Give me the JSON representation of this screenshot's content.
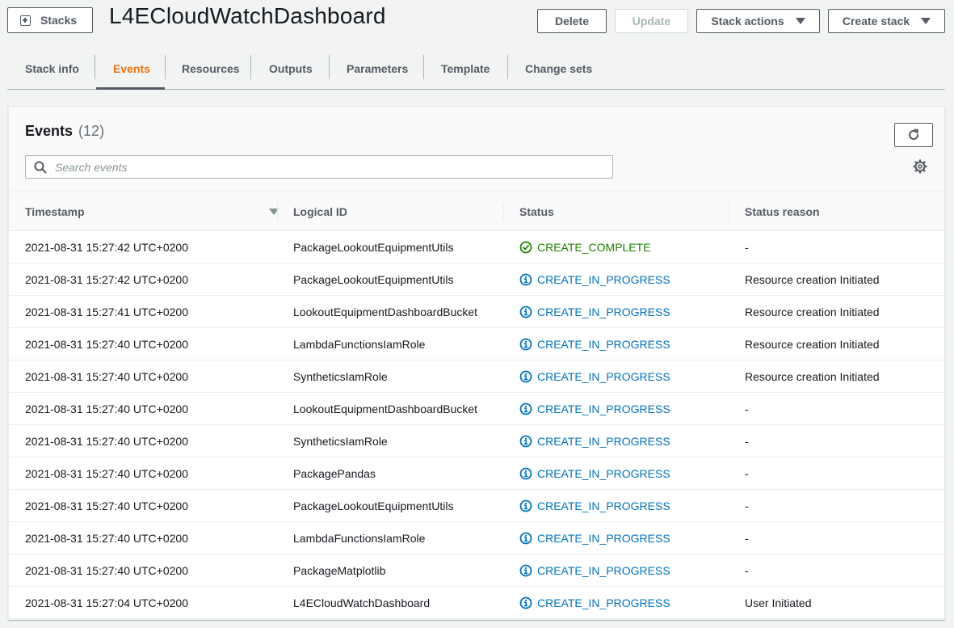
{
  "header": {
    "stacks_label": "Stacks",
    "title": "L4ECloudWatchDashboard",
    "delete_label": "Delete",
    "update_label": "Update",
    "stack_actions_label": "Stack actions",
    "create_stack_label": "Create stack"
  },
  "tabs": [
    {
      "label": "Stack info"
    },
    {
      "label": "Events",
      "active": true
    },
    {
      "label": "Resources"
    },
    {
      "label": "Outputs"
    },
    {
      "label": "Parameters"
    },
    {
      "label": "Template"
    },
    {
      "label": "Change sets"
    }
  ],
  "events": {
    "title": "Events",
    "count": "(12)",
    "search_placeholder": "Search events",
    "columns": {
      "timestamp": "Timestamp",
      "logical_id": "Logical ID",
      "status": "Status",
      "status_reason": "Status reason"
    },
    "rows": [
      {
        "timestamp": "2021-08-31 15:27:42 UTC+0200",
        "logical_id": "PackageLookoutEquipmentUtils",
        "status": "CREATE_COMPLETE",
        "status_type": "complete",
        "reason": "-"
      },
      {
        "timestamp": "2021-08-31 15:27:42 UTC+0200",
        "logical_id": "PackageLookoutEquipmentUtils",
        "status": "CREATE_IN_PROGRESS",
        "status_type": "progress",
        "reason": "Resource creation Initiated"
      },
      {
        "timestamp": "2021-08-31 15:27:41 UTC+0200",
        "logical_id": "LookoutEquipmentDashboardBucket",
        "status": "CREATE_IN_PROGRESS",
        "status_type": "progress",
        "reason": "Resource creation Initiated"
      },
      {
        "timestamp": "2021-08-31 15:27:40 UTC+0200",
        "logical_id": "LambdaFunctionsIamRole",
        "status": "CREATE_IN_PROGRESS",
        "status_type": "progress",
        "reason": "Resource creation Initiated"
      },
      {
        "timestamp": "2021-08-31 15:27:40 UTC+0200",
        "logical_id": "SyntheticsIamRole",
        "status": "CREATE_IN_PROGRESS",
        "status_type": "progress",
        "reason": "Resource creation Initiated"
      },
      {
        "timestamp": "2021-08-31 15:27:40 UTC+0200",
        "logical_id": "LookoutEquipmentDashboardBucket",
        "status": "CREATE_IN_PROGRESS",
        "status_type": "progress",
        "reason": "-"
      },
      {
        "timestamp": "2021-08-31 15:27:40 UTC+0200",
        "logical_id": "SyntheticsIamRole",
        "status": "CREATE_IN_PROGRESS",
        "status_type": "progress",
        "reason": "-"
      },
      {
        "timestamp": "2021-08-31 15:27:40 UTC+0200",
        "logical_id": "PackagePandas",
        "status": "CREATE_IN_PROGRESS",
        "status_type": "progress",
        "reason": "-"
      },
      {
        "timestamp": "2021-08-31 15:27:40 UTC+0200",
        "logical_id": "PackageLookoutEquipmentUtils",
        "status": "CREATE_IN_PROGRESS",
        "status_type": "progress",
        "reason": "-"
      },
      {
        "timestamp": "2021-08-31 15:27:40 UTC+0200",
        "logical_id": "LambdaFunctionsIamRole",
        "status": "CREATE_IN_PROGRESS",
        "status_type": "progress",
        "reason": "-"
      },
      {
        "timestamp": "2021-08-31 15:27:40 UTC+0200",
        "logical_id": "PackageMatplotlib",
        "status": "CREATE_IN_PROGRESS",
        "status_type": "progress",
        "reason": "-"
      },
      {
        "timestamp": "2021-08-31 15:27:04 UTC+0200",
        "logical_id": "L4ECloudWatchDashboard",
        "status": "CREATE_IN_PROGRESS",
        "status_type": "progress",
        "reason": "User Initiated"
      }
    ]
  },
  "icons": {
    "stacks": "plus-square-icon",
    "refresh": "refresh-icon",
    "search": "search-icon",
    "settings": "gear-icon",
    "sort": "caret-down-icon",
    "status_complete": "check-circle-icon",
    "status_progress": "info-circle-icon"
  },
  "colors": {
    "accent": "#ec7211",
    "status_complete": "#1d8102",
    "status_progress": "#0073bb"
  }
}
